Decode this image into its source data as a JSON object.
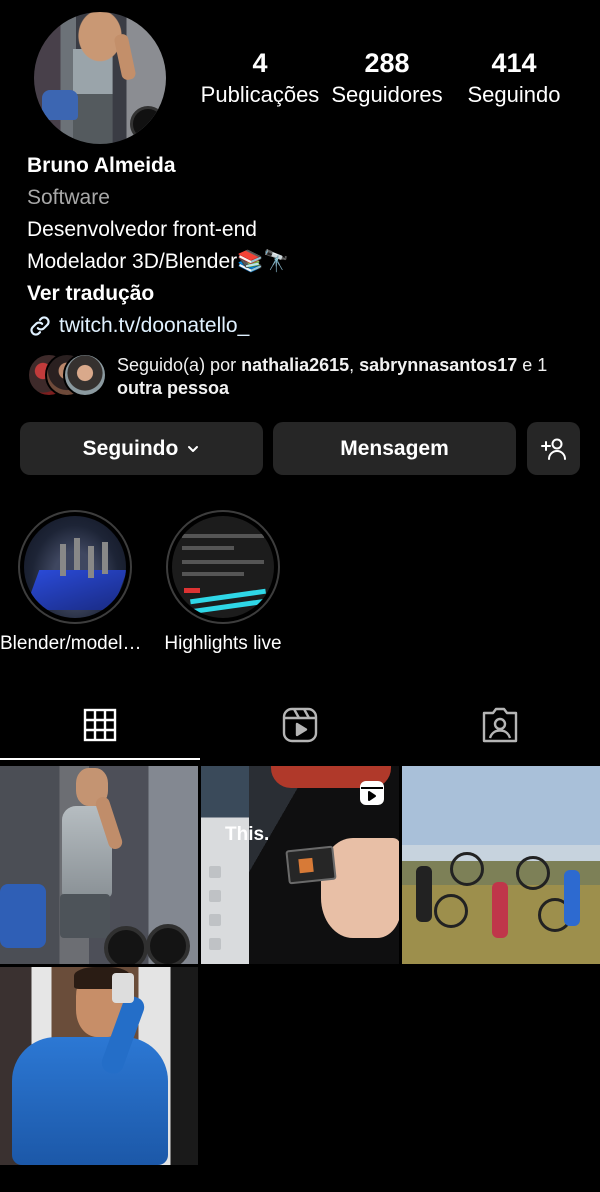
{
  "profile": {
    "stats": [
      {
        "count": "4",
        "label": "Publicações"
      },
      {
        "count": "288",
        "label": "Seguidores"
      },
      {
        "count": "414",
        "label": "Seguindo"
      }
    ],
    "name": "Bruno Almeida",
    "category": "Software",
    "bio_line_1": "Desenvolvedor front-end",
    "bio_line_2": "Modelador 3D/Blender📚🔭",
    "translate_label": "Ver tradução",
    "link": "twitch.tv/doonatello_"
  },
  "followed_by": {
    "prefix": "Seguido(a) por ",
    "user1": "nathalia2615",
    "sep": ", ",
    "user2": "sabrynnasantos17",
    "suffix": " e 1",
    "rest": "outra pessoa"
  },
  "actions": {
    "following_label": "Seguindo",
    "message_label": "Mensagem",
    "add_icon": "add-person-icon"
  },
  "highlights": [
    {
      "label": "Blender/modelagem"
    },
    {
      "label": "Highlights live"
    }
  ],
  "tabs": {
    "icons": [
      "grid-icon",
      "reels-icon",
      "tagged-icon"
    ]
  },
  "posts": [
    {
      "overlay_text": ""
    },
    {
      "overlay_text": "This.",
      "is_reel": true
    },
    {
      "overlay_text": ""
    },
    {
      "overlay_text": ""
    }
  ],
  "colors": {
    "background": "#000000",
    "button": "#262626",
    "secondary_text": "#a8a8a8",
    "link_text": "#e0f1ff",
    "underline": "#ffffff"
  }
}
